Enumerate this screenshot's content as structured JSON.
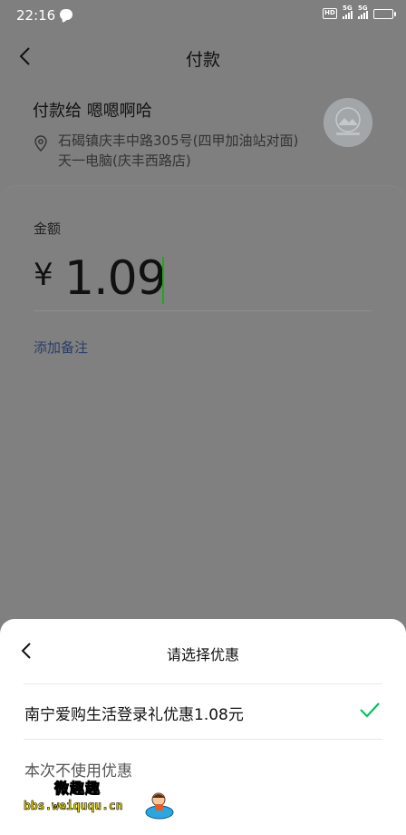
{
  "status_bar": {
    "time": "22:16",
    "hd_badge": "HD",
    "signal_1": "5G",
    "signal_2": "5G",
    "battery_color": "#f0c020"
  },
  "header": {
    "title": "付款"
  },
  "payee": {
    "name": "付款给 嗯嗯啊哈",
    "address": "石碣镇庆丰中路305号(四甲加油站对面)天一电脑(庆丰西路店)"
  },
  "amount": {
    "label": "金额",
    "currency_symbol": "¥",
    "value": "1.09"
  },
  "note": {
    "add_label": "添加备注"
  },
  "coupon_sheet": {
    "title": "请选择优惠",
    "options": [
      {
        "label": "南宁爱购生活登录礼优惠1.08元",
        "selected": true
      },
      {
        "label": "本次不使用优惠",
        "selected": false
      }
    ],
    "accent_color": "#07c160"
  },
  "watermark": {
    "title": "微趣趣",
    "url": "bbs.weiququ.cn"
  }
}
